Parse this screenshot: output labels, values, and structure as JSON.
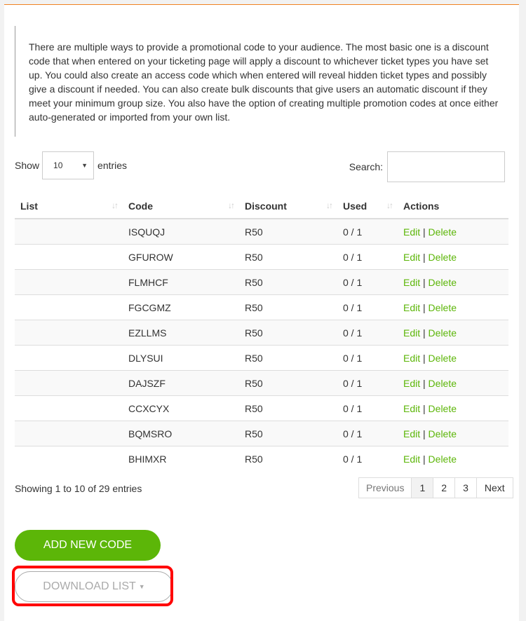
{
  "intro": {
    "text": "There are multiple ways to provide a promotional code to your audience. The most basic one is a discount code that when entered on your ticketing page will apply a discount to whichever ticket types you have set up. You could also create an access code which when entered will reveal hidden ticket types and possibly give a discount if needed. You can also create bulk discounts that give users an automatic discount if they meet your minimum group size. You also have the option of creating multiple promotion codes at once either auto-generated or imported from your own list."
  },
  "length": {
    "show_label": "Show",
    "value": "10",
    "entries_label": "entries"
  },
  "search": {
    "label": "Search:",
    "value": "",
    "placeholder": ""
  },
  "table": {
    "headers": [
      "List",
      "Code",
      "Discount",
      "Used",
      "Actions"
    ],
    "rows": [
      {
        "list": "",
        "code": "ISQUQJ",
        "discount": "R50",
        "used": "0 / 1"
      },
      {
        "list": "",
        "code": "GFUROW",
        "discount": "R50",
        "used": "0 / 1"
      },
      {
        "list": "",
        "code": "FLMHCF",
        "discount": "R50",
        "used": "0 / 1"
      },
      {
        "list": "",
        "code": "FGCGMZ",
        "discount": "R50",
        "used": "0 / 1"
      },
      {
        "list": "",
        "code": "EZLLMS",
        "discount": "R50",
        "used": "0 / 1"
      },
      {
        "list": "",
        "code": "DLYSUI",
        "discount": "R50",
        "used": "0 / 1"
      },
      {
        "list": "",
        "code": "DAJSZF",
        "discount": "R50",
        "used": "0 / 1"
      },
      {
        "list": "",
        "code": "CCXCYX",
        "discount": "R50",
        "used": "0 / 1"
      },
      {
        "list": "",
        "code": "BQMSRO",
        "discount": "R50",
        "used": "0 / 1"
      },
      {
        "list": "",
        "code": "BHIMXR",
        "discount": "R50",
        "used": "0 / 1"
      }
    ],
    "edit_label": "Edit",
    "separator": "|",
    "delete_label": "Delete"
  },
  "info": "Showing 1 to 10 of 29 entries",
  "pagination": {
    "previous": "Previous",
    "pages": [
      "1",
      "2",
      "3"
    ],
    "active": "1",
    "next": "Next"
  },
  "buttons": {
    "add": "ADD NEW CODE",
    "download": "DOWNLOAD LIST"
  },
  "colors": {
    "accent_orange": "#f08321",
    "green": "#5cb608",
    "highlight_red": "#ff0000"
  }
}
